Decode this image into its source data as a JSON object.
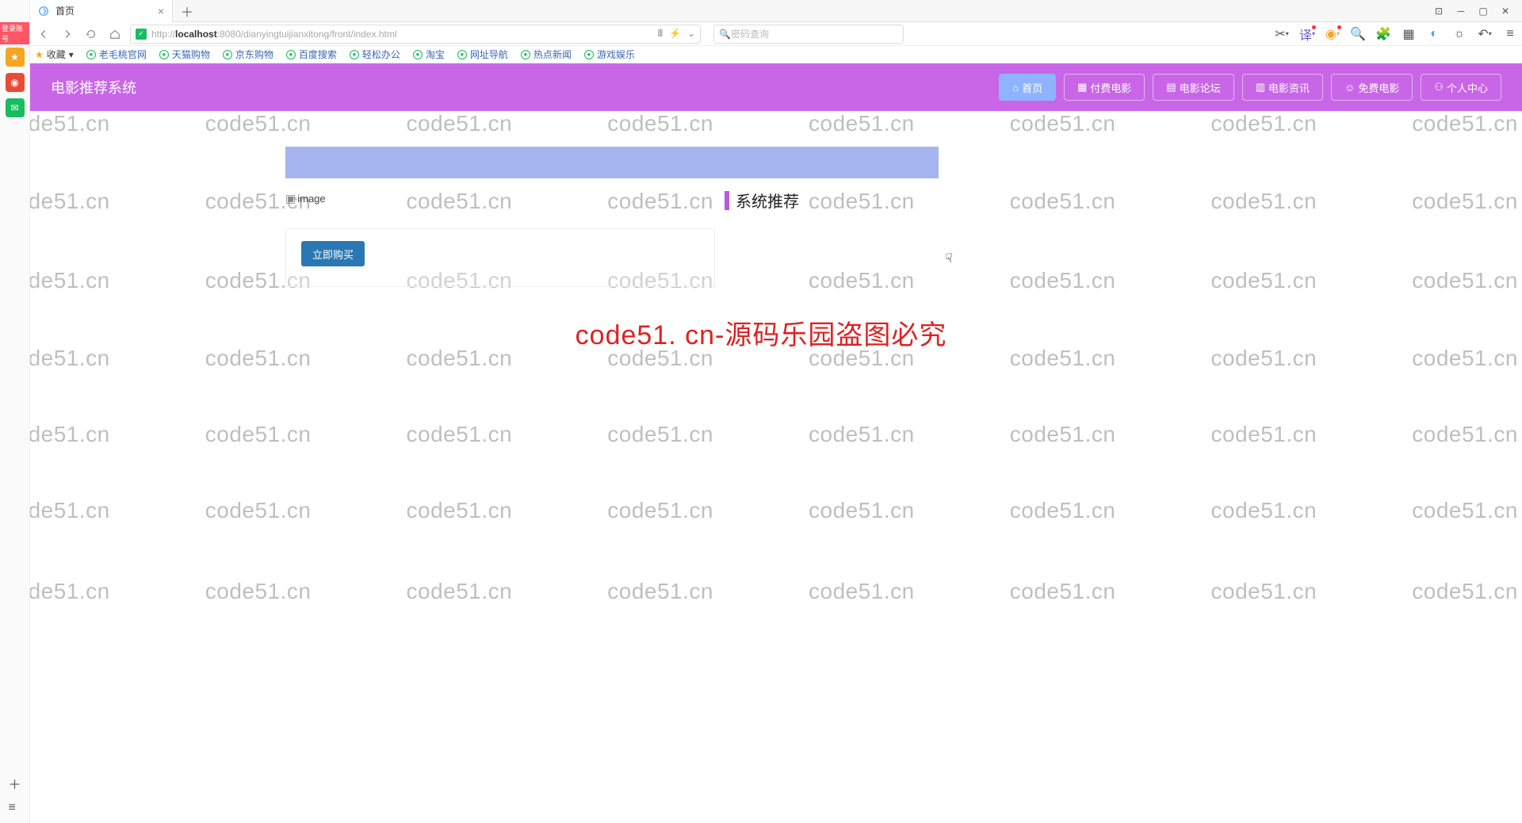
{
  "browser": {
    "tab_title": "首页",
    "url_prefix": "http://",
    "url_host": "localhost",
    "url_port": ":8080",
    "url_path": "/dianyingtuijianxitong/front/index.html",
    "search_placeholder": "密码查询",
    "login_badge": "登录账号"
  },
  "bookmarks": {
    "fav": "收藏",
    "items": [
      "老毛桃官网",
      "天猫购物",
      "京东购物",
      "百度搜索",
      "轻松办公",
      "淘宝",
      "网址导航",
      "热点新闻",
      "游戏娱乐"
    ]
  },
  "page": {
    "title": "电影推荐系统",
    "nav": [
      {
        "icon": "⌂",
        "label": "首页",
        "active": true
      },
      {
        "icon": "▦",
        "label": "付费电影"
      },
      {
        "icon": "▤",
        "label": "电影论坛"
      },
      {
        "icon": "▥",
        "label": "电影资讯"
      },
      {
        "icon": "☺",
        "label": "免费电影"
      },
      {
        "icon": "⚇",
        "label": "个人中心"
      }
    ],
    "image_alt": "image",
    "buy_button": "立即购买",
    "recommend_title": "系统推荐"
  },
  "watermark": {
    "text": "code51.cn",
    "center": "code51. cn-源码乐园盗图必究"
  }
}
